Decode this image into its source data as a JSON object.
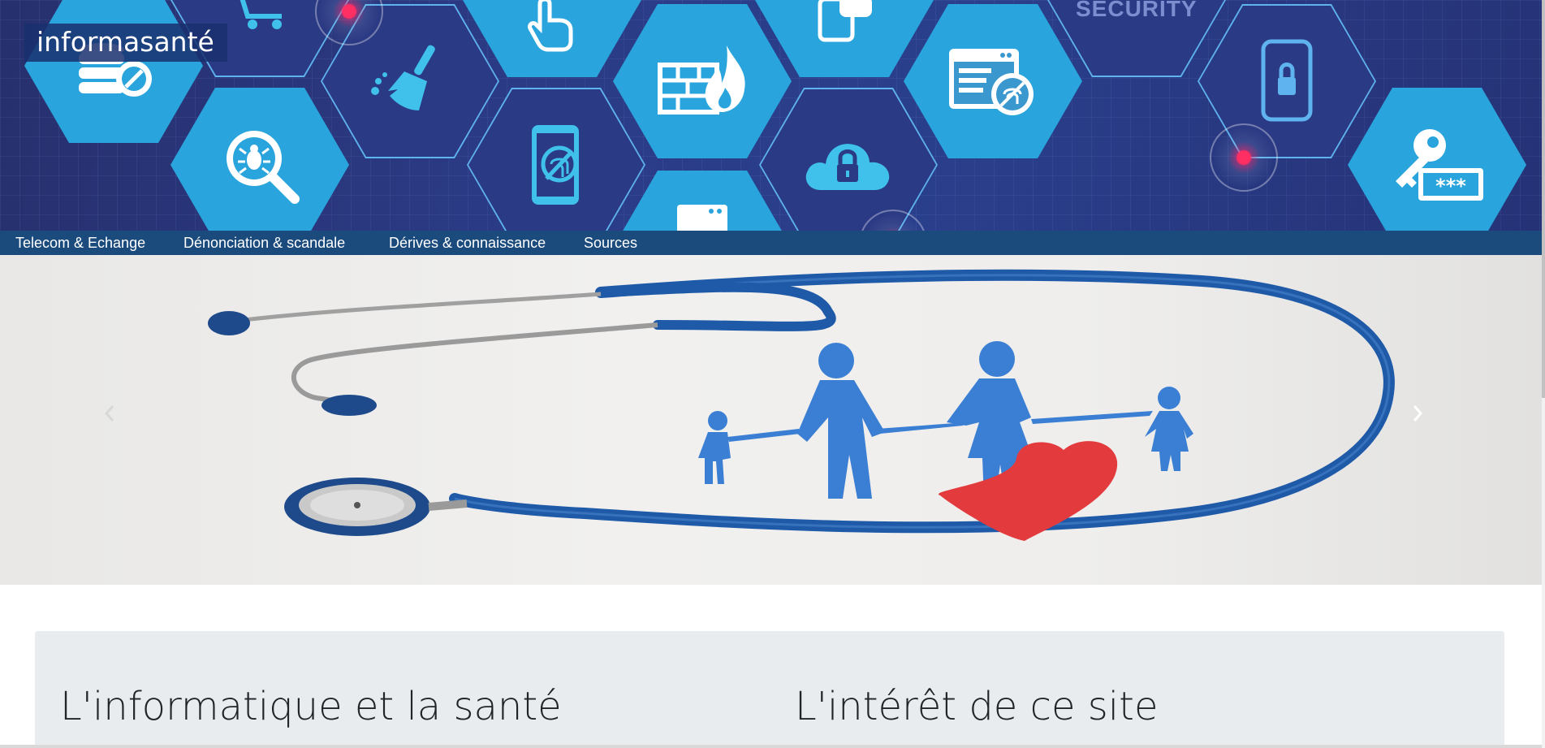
{
  "site": {
    "title": "informasanté"
  },
  "banner": {
    "watermark": "SECURITY",
    "icons": [
      "database-blocked-icon",
      "shopping-cart-icon",
      "broom-icon",
      "bug-search-icon",
      "hand-pointer-icon",
      "firewall-icon",
      "mobile-fingerprint-icon",
      "chat-phone-icon",
      "cloud-lock-icon",
      "document-fingerprint-icon",
      "phone-lock-icon",
      "key-password-icon",
      "browser-window-icon"
    ]
  },
  "nav": {
    "items": [
      {
        "label": "Telecom & Echange"
      },
      {
        "label": "Dénonciation & scandale"
      },
      {
        "label": "Dérives & connaissance"
      },
      {
        "label": "Sources"
      }
    ]
  },
  "carousel": {
    "image": "stethoscope-family-heart-image",
    "prev_icon": "chevron-left-icon",
    "next_icon": "chevron-right-icon"
  },
  "cards": [
    {
      "title": "L'informatique et la santé"
    },
    {
      "title": "L'intérêt de ce site"
    }
  ],
  "colors": {
    "banner": "#2b3a84",
    "nav": "#1b4b7d",
    "hex_fill": "#2aa4dc",
    "card_bg": "#e9ecef",
    "stethoscope": "#1e5aa8",
    "family": "#3a7fd4",
    "heart": "#e23a3d"
  }
}
